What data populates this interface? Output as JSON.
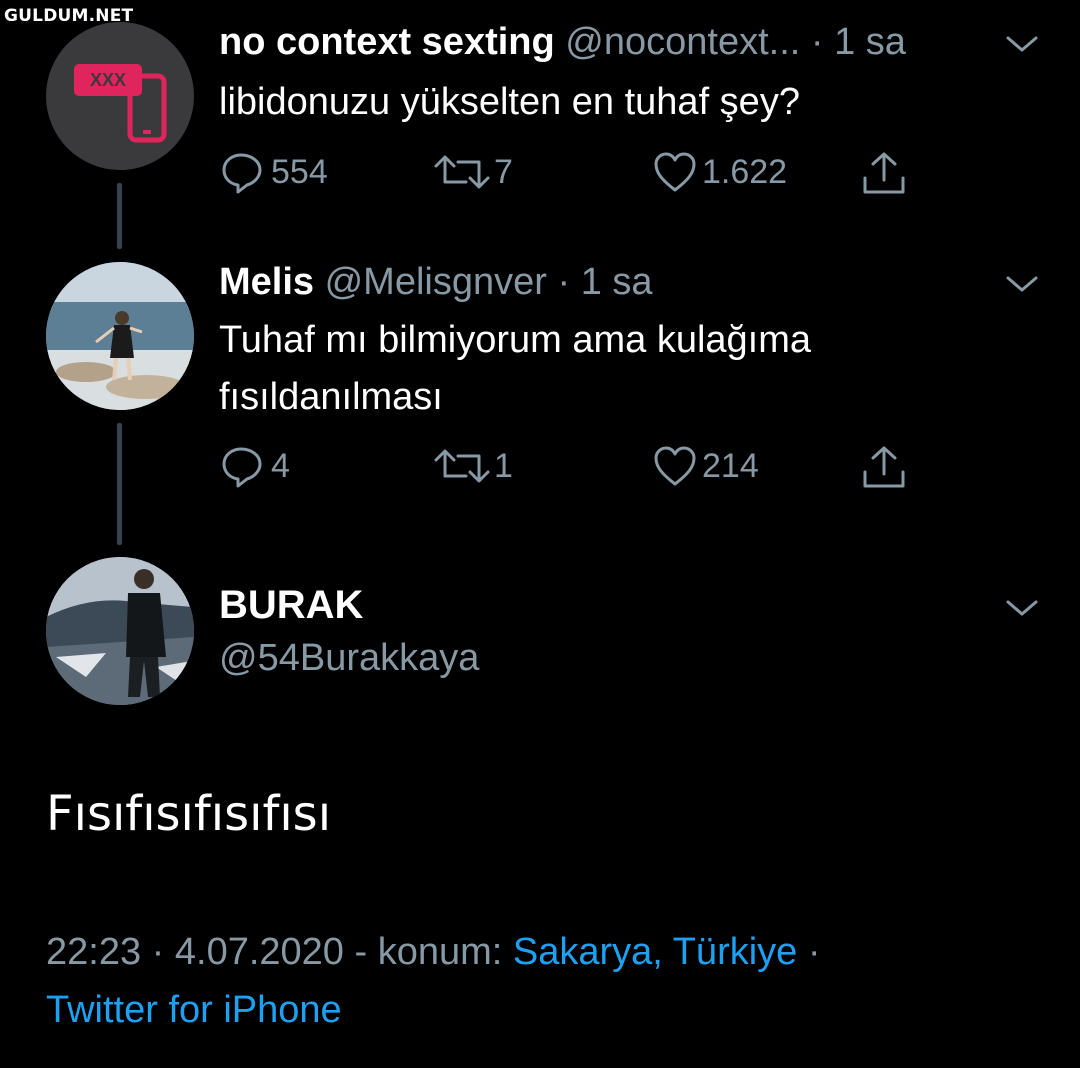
{
  "watermark": "GULDUM.NET",
  "colors": {
    "background": "#000000",
    "secondary_text": "#8899a6",
    "link": "#1da1f2",
    "thread_line": "#38444d",
    "avatar_badge": "#e0245e"
  },
  "tweets": [
    {
      "name": "no context sexting",
      "handle": "@nocontext...",
      "separator": "·",
      "time": "1 sa",
      "text": "libidonuzu yükselten en tuhaf şey?",
      "avatar_badge": "XXX",
      "replies": "554",
      "retweets": "7",
      "likes": "1.622"
    },
    {
      "name": "Melis",
      "handle": "@Melisgnver",
      "separator": "·",
      "time": "1 sa",
      "text_line1": "Tuhaf mı bilmiyorum ama kulağıma",
      "text_line2": "fısıldanılması",
      "replies": "4",
      "retweets": "1",
      "likes": "214"
    }
  ],
  "focus_tweet": {
    "name": "BURAK",
    "handle": "@54Burakkaya",
    "text": "Fısıfısıfısıfısı",
    "time": "22:23",
    "date": "4.07.2020",
    "location_prefix": "- konum:",
    "location": "Sakarya, Türkiye",
    "separator": "·",
    "source": "Twitter for iPhone"
  },
  "icons": [
    "reply-icon",
    "retweet-icon",
    "like-icon",
    "share-icon",
    "chevron-down-icon"
  ]
}
